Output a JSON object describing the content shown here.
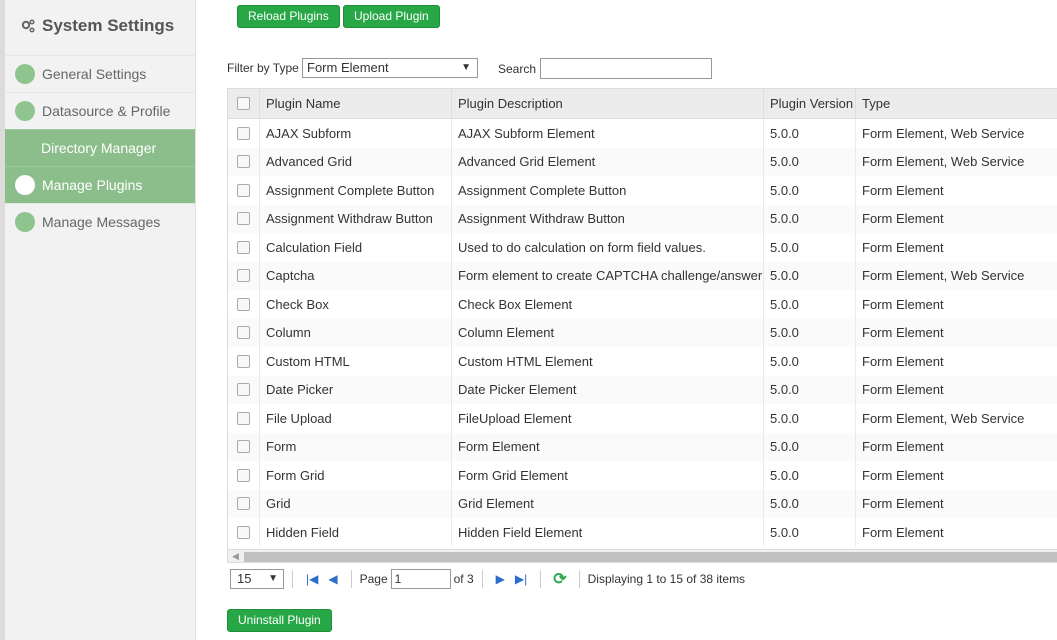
{
  "sidebar": {
    "title": "System Settings",
    "items": [
      {
        "label": "General Settings",
        "dot": true,
        "highlight": false
      },
      {
        "label": "Datasource & Profile",
        "dot": true,
        "highlight": false
      },
      {
        "label": "Directory Manager",
        "dot": false,
        "highlight": true
      },
      {
        "label": "Manage Plugins",
        "dot": true,
        "highlight": true
      },
      {
        "label": "Manage Messages",
        "dot": true,
        "highlight": false
      }
    ]
  },
  "toolbar": {
    "reload_label": "Reload Plugins",
    "upload_label": "Upload Plugin"
  },
  "filter": {
    "label": "Filter by Type",
    "selected": "Form Element",
    "search_label": "Search",
    "search_value": ""
  },
  "table": {
    "headers": [
      "Plugin Name",
      "Plugin Description",
      "Plugin Version",
      "Type"
    ],
    "rows": [
      {
        "name": "AJAX Subform",
        "desc": "AJAX Subform Element",
        "version": "5.0.0",
        "type": "Form Element, Web Service"
      },
      {
        "name": "Advanced Grid",
        "desc": "Advanced Grid Element",
        "version": "5.0.0",
        "type": "Form Element, Web Service"
      },
      {
        "name": "Assignment Complete Button",
        "desc": "Assignment Complete Button",
        "version": "5.0.0",
        "type": "Form Element"
      },
      {
        "name": "Assignment Withdraw Button",
        "desc": "Assignment Withdraw Button",
        "version": "5.0.0",
        "type": "Form Element"
      },
      {
        "name": "Calculation Field",
        "desc": "Used to do calculation on form field values.",
        "version": "5.0.0",
        "type": "Form Element"
      },
      {
        "name": "Captcha",
        "desc": "Form element to create CAPTCHA challenge/answer",
        "version": "5.0.0",
        "type": "Form Element, Web Service"
      },
      {
        "name": "Check Box",
        "desc": "Check Box Element",
        "version": "5.0.0",
        "type": "Form Element"
      },
      {
        "name": "Column",
        "desc": "Column Element",
        "version": "5.0.0",
        "type": "Form Element"
      },
      {
        "name": "Custom HTML",
        "desc": "Custom HTML Element",
        "version": "5.0.0",
        "type": "Form Element"
      },
      {
        "name": "Date Picker",
        "desc": "Date Picker Element",
        "version": "5.0.0",
        "type": "Form Element"
      },
      {
        "name": "File Upload",
        "desc": "FileUpload Element",
        "version": "5.0.0",
        "type": "Form Element, Web Service"
      },
      {
        "name": "Form",
        "desc": "Form Element",
        "version": "5.0.0",
        "type": "Form Element"
      },
      {
        "name": "Form Grid",
        "desc": "Form Grid Element",
        "version": "5.0.0",
        "type": "Form Element"
      },
      {
        "name": "Grid",
        "desc": "Grid Element",
        "version": "5.0.0",
        "type": "Form Element"
      },
      {
        "name": "Hidden Field",
        "desc": "Hidden Field Element",
        "version": "5.0.0",
        "type": "Form Element"
      }
    ]
  },
  "pager": {
    "page_size": "15",
    "page_label": "Page",
    "page_value": "1",
    "of_label": "of 3",
    "display_text": "Displaying 1 to 15 of 38 items"
  },
  "footer": {
    "uninstall_label": "Uninstall Plugin"
  },
  "colors": {
    "accent": "#27a745",
    "menu_highlight": "#8cbe8c"
  }
}
